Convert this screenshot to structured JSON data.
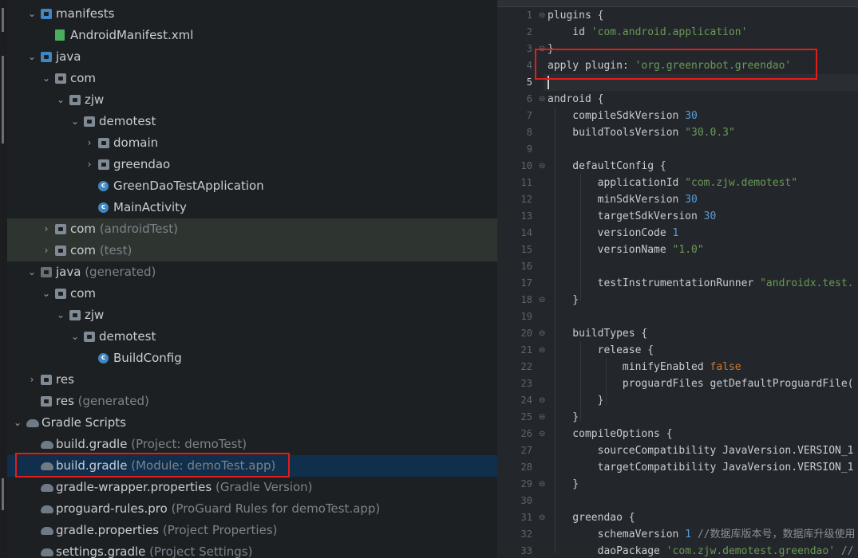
{
  "tree": [
    {
      "label": "manifests",
      "suffix": "",
      "icon": "folder-blue",
      "icon_name": "folder-icon",
      "chev": "v",
      "depth": 1
    },
    {
      "label": "AndroidManifest.xml",
      "suffix": "",
      "icon": "xml",
      "icon_name": "xml-file-icon",
      "chev": "",
      "depth": 2
    },
    {
      "label": "java",
      "suffix": "",
      "icon": "folder-blue",
      "icon_name": "folder-icon",
      "chev": "v",
      "depth": 1
    },
    {
      "label": "com",
      "suffix": "",
      "icon": "folder",
      "icon_name": "package-icon",
      "chev": "v",
      "depth": 2
    },
    {
      "label": "zjw",
      "suffix": "",
      "icon": "folder",
      "icon_name": "package-icon",
      "chev": "v",
      "depth": 3
    },
    {
      "label": "demotest",
      "suffix": "",
      "icon": "folder",
      "icon_name": "package-icon",
      "chev": "v",
      "depth": 4
    },
    {
      "label": "domain",
      "suffix": "",
      "icon": "folder",
      "icon_name": "package-icon",
      "chev": ">",
      "depth": 5
    },
    {
      "label": "greendao",
      "suffix": "",
      "icon": "folder",
      "icon_name": "package-icon",
      "chev": ">",
      "depth": 5
    },
    {
      "label": "GreenDaoTestApplication",
      "suffix": "",
      "icon": "class",
      "icon_name": "class-icon",
      "chev": "",
      "depth": 5
    },
    {
      "label": "MainActivity",
      "suffix": "",
      "icon": "class",
      "icon_name": "class-icon",
      "chev": "",
      "depth": 5
    },
    {
      "label": "com",
      "suffix": " (androidTest)",
      "icon": "folder",
      "icon_name": "package-icon",
      "chev": ">",
      "depth": 2,
      "test": true
    },
    {
      "label": "com",
      "suffix": " (test)",
      "icon": "folder",
      "icon_name": "package-icon",
      "chev": ">",
      "depth": 2,
      "test": true
    },
    {
      "label": "java",
      "suffix": " (generated)",
      "icon": "folder-gen",
      "icon_name": "generated-folder-icon",
      "chev": "v",
      "depth": 1
    },
    {
      "label": "com",
      "suffix": "",
      "icon": "folder",
      "icon_name": "package-icon",
      "chev": "v",
      "depth": 2
    },
    {
      "label": "zjw",
      "suffix": "",
      "icon": "folder",
      "icon_name": "package-icon",
      "chev": "v",
      "depth": 3
    },
    {
      "label": "demotest",
      "suffix": "",
      "icon": "folder",
      "icon_name": "package-icon",
      "chev": "v",
      "depth": 4
    },
    {
      "label": "BuildConfig",
      "suffix": "",
      "icon": "class",
      "icon_name": "class-icon",
      "chev": "",
      "depth": 5
    },
    {
      "label": "res",
      "suffix": "",
      "icon": "folder",
      "icon_name": "folder-icon",
      "chev": ">",
      "depth": 1
    },
    {
      "label": "res",
      "suffix": " (generated)",
      "icon": "folder",
      "icon_name": "folder-icon",
      "chev": "",
      "depth": 1
    },
    {
      "label": "Gradle Scripts",
      "suffix": "",
      "icon": "gradle",
      "icon_name": "gradle-icon",
      "chev": "v",
      "depth": 0
    },
    {
      "label": "build.gradle",
      "suffix": " (Project: demoTest)",
      "icon": "gradle",
      "icon_name": "gradle-icon",
      "chev": "",
      "depth": 1
    },
    {
      "label": "build.gradle",
      "suffix": " (Module: demoTest.app)",
      "icon": "gradle",
      "icon_name": "gradle-icon",
      "chev": "",
      "depth": 1,
      "selected": true
    },
    {
      "label": "gradle-wrapper.properties",
      "suffix": " (Gradle Version)",
      "icon": "gradle",
      "icon_name": "gradle-icon",
      "chev": "",
      "depth": 1
    },
    {
      "label": "proguard-rules.pro",
      "suffix": " (ProGuard Rules for demoTest.app)",
      "icon": "gradle",
      "icon_name": "gradle-icon",
      "chev": "",
      "depth": 1
    },
    {
      "label": "gradle.properties",
      "suffix": " (Project Properties)",
      "icon": "gradle",
      "icon_name": "gradle-icon",
      "chev": "",
      "depth": 1
    },
    {
      "label": "settings.gradle",
      "suffix": " (Project Settings)",
      "icon": "gradle",
      "icon_name": "gradle-icon",
      "chev": "",
      "depth": 1
    }
  ],
  "code": [
    {
      "n": "1",
      "fold": "⊖",
      "tokens": [
        [
          "plugins {",
          ""
        ]
      ]
    },
    {
      "n": "2",
      "tokens": [
        [
          "    id ",
          ""
        ],
        [
          "'com.android.application'",
          "str"
        ]
      ]
    },
    {
      "n": "3",
      "fold": "⊖",
      "tokens": [
        [
          "}",
          ""
        ]
      ]
    },
    {
      "n": "4",
      "tokens": [
        [
          "apply plugin: ",
          ""
        ],
        [
          "'org.greenrobot.greendao'",
          "str"
        ]
      ]
    },
    {
      "n": "5",
      "tokens": []
    },
    {
      "n": "6",
      "fold": "⊖",
      "tokens": [
        [
          "android {",
          ""
        ]
      ]
    },
    {
      "n": "7",
      "tokens": [
        [
          "    compileSdkVersion ",
          ""
        ],
        [
          "30",
          "num"
        ]
      ]
    },
    {
      "n": "8",
      "tokens": [
        [
          "    buildToolsVersion ",
          ""
        ],
        [
          "\"30.0.3\"",
          "str"
        ]
      ]
    },
    {
      "n": "9",
      "tokens": []
    },
    {
      "n": "10",
      "fold": "⊖",
      "tokens": [
        [
          "    defaultConfig {",
          ""
        ]
      ]
    },
    {
      "n": "11",
      "tokens": [
        [
          "        applicationId ",
          ""
        ],
        [
          "\"com.zjw.demotest\"",
          "str"
        ]
      ]
    },
    {
      "n": "12",
      "tokens": [
        [
          "        minSdkVersion ",
          ""
        ],
        [
          "30",
          "num"
        ]
      ]
    },
    {
      "n": "13",
      "tokens": [
        [
          "        targetSdkVersion ",
          ""
        ],
        [
          "30",
          "num"
        ]
      ]
    },
    {
      "n": "14",
      "tokens": [
        [
          "        versionCode ",
          ""
        ],
        [
          "1",
          "num"
        ]
      ]
    },
    {
      "n": "15",
      "tokens": [
        [
          "        versionName ",
          ""
        ],
        [
          "\"1.0\"",
          "str"
        ]
      ]
    },
    {
      "n": "16",
      "tokens": []
    },
    {
      "n": "17",
      "tokens": [
        [
          "        testInstrumentationRunner ",
          ""
        ],
        [
          "\"androidx.test.",
          "str"
        ]
      ]
    },
    {
      "n": "18",
      "fold": "⊖",
      "tokens": [
        [
          "    }",
          ""
        ]
      ]
    },
    {
      "n": "19",
      "tokens": []
    },
    {
      "n": "20",
      "fold": "⊖",
      "tokens": [
        [
          "    buildTypes {",
          ""
        ]
      ]
    },
    {
      "n": "21",
      "fold": "⊖",
      "tokens": [
        [
          "        release {",
          ""
        ]
      ]
    },
    {
      "n": "22",
      "tokens": [
        [
          "            minifyEnabled ",
          ""
        ],
        [
          "false",
          "kw"
        ]
      ]
    },
    {
      "n": "23",
      "tokens": [
        [
          "            proguardFiles getDefaultProguardFile(",
          ""
        ]
      ]
    },
    {
      "n": "24",
      "fold": "⊖",
      "tokens": [
        [
          "        }",
          ""
        ]
      ]
    },
    {
      "n": "25",
      "fold": "⊖",
      "tokens": [
        [
          "    }",
          ""
        ]
      ]
    },
    {
      "n": "26",
      "fold": "⊖",
      "tokens": [
        [
          "    compileOptions {",
          ""
        ]
      ]
    },
    {
      "n": "27",
      "tokens": [
        [
          "        sourceCompatibility JavaVersion.VERSION_1",
          ""
        ]
      ]
    },
    {
      "n": "28",
      "tokens": [
        [
          "        targetCompatibility JavaVersion.VERSION_1",
          ""
        ]
      ]
    },
    {
      "n": "29",
      "fold": "⊖",
      "tokens": [
        [
          "    }",
          ""
        ]
      ]
    },
    {
      "n": "30",
      "tokens": []
    },
    {
      "n": "31",
      "fold": "⊖",
      "tokens": [
        [
          "    greendao {",
          ""
        ]
      ]
    },
    {
      "n": "32",
      "tokens": [
        [
          "        schemaVersion ",
          ""
        ],
        [
          "1",
          "num"
        ],
        [
          " //数据库版本号，数据库升级使用",
          "cm"
        ]
      ]
    },
    {
      "n": "33",
      "tokens": [
        [
          "        daoPackage ",
          ""
        ],
        [
          "'com.zjw.demotest.greendao'",
          "str"
        ],
        [
          " //",
          "cm"
        ]
      ]
    }
  ]
}
